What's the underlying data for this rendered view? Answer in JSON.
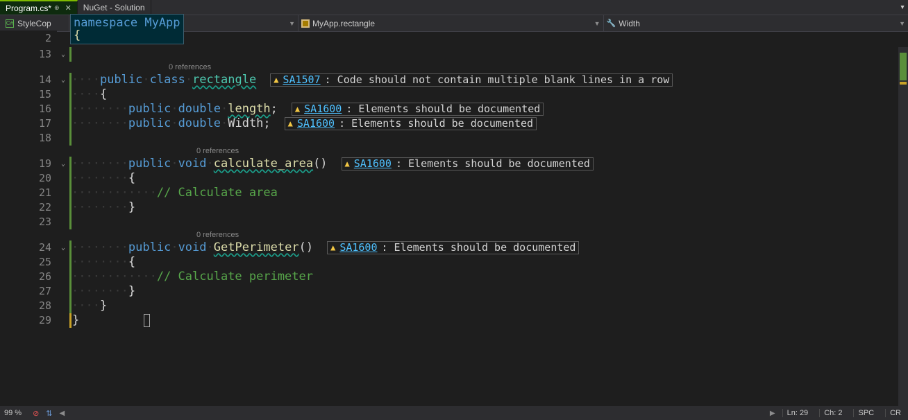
{
  "tabs": {
    "active": "Program.cs*",
    "second": "NuGet - Solution"
  },
  "stylecop_label": "StyleCop",
  "tooltip": {
    "line1": "namespace MyApp",
    "line2": "{"
  },
  "breadcrumbs": {
    "first": "",
    "second": "MyApp.rectangle",
    "third": "Width"
  },
  "stray_lineno": "2",
  "code_lines": [
    {
      "n": "13",
      "fold": true,
      "bar": "green",
      "text": ""
    },
    {
      "n": "",
      "fold": false,
      "bar": "",
      "codelens": "0 references",
      "indent": 14
    },
    {
      "n": "14",
      "fold": true,
      "bar": "green",
      "segments": [
        {
          "t": "dots",
          "c": 4
        },
        {
          "t": "kw",
          "v": "public"
        },
        {
          "t": "sp"
        },
        {
          "t": "kw",
          "v": "class"
        },
        {
          "t": "sp"
        },
        {
          "t": "type-wavy",
          "v": "rectangle"
        }
      ],
      "warn": {
        "code": "SA1507",
        "msg": "Code should not contain multiple blank lines in a row"
      }
    },
    {
      "n": "15",
      "fold": false,
      "bar": "green",
      "segments": [
        {
          "t": "dots",
          "c": 4
        },
        {
          "t": "brace",
          "v": "{"
        }
      ]
    },
    {
      "n": "16",
      "fold": false,
      "bar": "green",
      "segments": [
        {
          "t": "dots",
          "c": 8
        },
        {
          "t": "kw",
          "v": "public"
        },
        {
          "t": "sp"
        },
        {
          "t": "kw",
          "v": "double"
        },
        {
          "t": "sp"
        },
        {
          "t": "ident-wavy",
          "v": "length"
        },
        {
          "t": "punct",
          "v": ";"
        }
      ],
      "warn": {
        "code": "SA1600",
        "msg": "Elements should be documented"
      }
    },
    {
      "n": "17",
      "fold": false,
      "bar": "green",
      "segments": [
        {
          "t": "dots",
          "c": 8
        },
        {
          "t": "kw",
          "v": "public"
        },
        {
          "t": "sp"
        },
        {
          "t": "kw",
          "v": "double"
        },
        {
          "t": "sp"
        },
        {
          "t": "ident",
          "v": "Width"
        },
        {
          "t": "punct",
          "v": ";"
        }
      ],
      "warn": {
        "code": "SA1600",
        "msg": "Elements should be documented"
      }
    },
    {
      "n": "18",
      "fold": false,
      "bar": "green",
      "text": ""
    },
    {
      "n": "",
      "fold": false,
      "bar": "",
      "codelens": "0 references",
      "indent": 18
    },
    {
      "n": "19",
      "fold": true,
      "bar": "green",
      "segments": [
        {
          "t": "dots",
          "c": 8
        },
        {
          "t": "kw",
          "v": "public"
        },
        {
          "t": "sp"
        },
        {
          "t": "kw",
          "v": "void"
        },
        {
          "t": "sp"
        },
        {
          "t": "method",
          "v": "calculate_area"
        },
        {
          "t": "punct",
          "v": "()"
        }
      ],
      "warn": {
        "code": "SA1600",
        "msg": "Elements should be documented"
      }
    },
    {
      "n": "20",
      "fold": false,
      "bar": "green",
      "segments": [
        {
          "t": "dots",
          "c": 8
        },
        {
          "t": "brace",
          "v": "{"
        }
      ]
    },
    {
      "n": "21",
      "fold": false,
      "bar": "green",
      "segments": [
        {
          "t": "dots",
          "c": 12
        },
        {
          "t": "comment",
          "v": "// Calculate area"
        }
      ]
    },
    {
      "n": "22",
      "fold": false,
      "bar": "green",
      "segments": [
        {
          "t": "dots",
          "c": 8
        },
        {
          "t": "brace",
          "v": "}"
        }
      ]
    },
    {
      "n": "23",
      "fold": false,
      "bar": "green",
      "text": ""
    },
    {
      "n": "",
      "fold": false,
      "bar": "",
      "codelens": "0 references",
      "indent": 18
    },
    {
      "n": "24",
      "fold": true,
      "bar": "green",
      "segments": [
        {
          "t": "dots",
          "c": 8
        },
        {
          "t": "kw",
          "v": "public"
        },
        {
          "t": "sp"
        },
        {
          "t": "kw",
          "v": "void"
        },
        {
          "t": "sp"
        },
        {
          "t": "method",
          "v": "GetPerimeter"
        },
        {
          "t": "punct",
          "v": "()"
        }
      ],
      "warn": {
        "code": "SA1600",
        "msg": "Elements should be documented"
      }
    },
    {
      "n": "25",
      "fold": false,
      "bar": "green",
      "segments": [
        {
          "t": "dots",
          "c": 8
        },
        {
          "t": "brace",
          "v": "{"
        }
      ]
    },
    {
      "n": "26",
      "fold": false,
      "bar": "green",
      "segments": [
        {
          "t": "dots",
          "c": 12
        },
        {
          "t": "comment",
          "v": "// Calculate perimeter"
        }
      ]
    },
    {
      "n": "27",
      "fold": false,
      "bar": "green",
      "segments": [
        {
          "t": "dots",
          "c": 8
        },
        {
          "t": "brace",
          "v": "}"
        }
      ]
    },
    {
      "n": "28",
      "fold": false,
      "bar": "green",
      "segments": [
        {
          "t": "dots",
          "c": 4
        },
        {
          "t": "brace",
          "v": "}"
        }
      ]
    },
    {
      "n": "29",
      "fold": false,
      "bar": "yellow",
      "segments": [
        {
          "t": "cursor-brace",
          "v": "}"
        }
      ]
    }
  ],
  "statusbar": {
    "zoom": "99 %",
    "ln": "Ln: 29",
    "ch": "Ch: 2",
    "spc": "SPC",
    "crlf": "CR"
  }
}
